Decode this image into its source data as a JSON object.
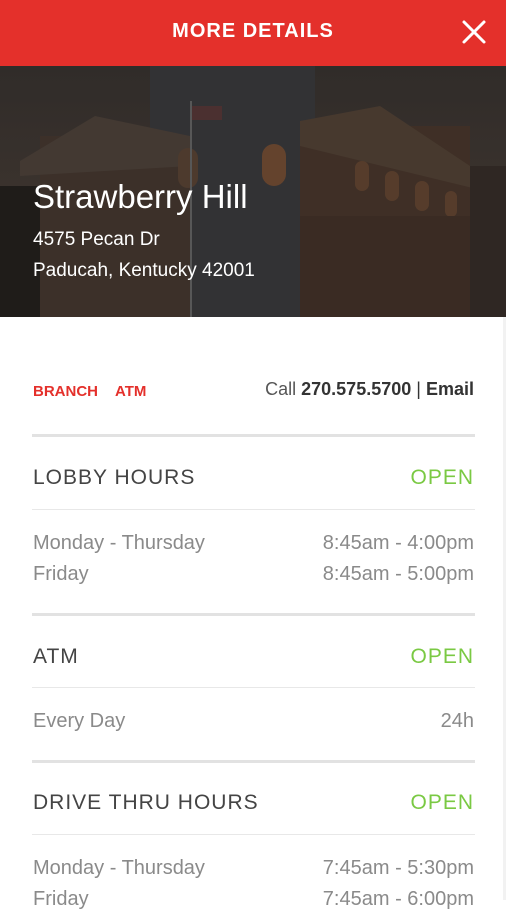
{
  "header": {
    "title": "MORE DETAILS"
  },
  "location": {
    "name": "Strawberry Hill",
    "address_line1": "4575 Pecan Dr",
    "address_line2": "Paducah, Kentucky 42001"
  },
  "tags": [
    "BRANCH",
    "ATM"
  ],
  "contact": {
    "call_label": "Call",
    "phone": "270.575.5700",
    "separator": "|",
    "email": "Email"
  },
  "sections": [
    {
      "title": "LOBBY HOURS",
      "status": "OPEN",
      "rows": [
        {
          "label": "Monday - Thursday",
          "time": "8:45am - 4:00pm"
        },
        {
          "label": "Friday",
          "time": "8:45am - 5:00pm"
        }
      ]
    },
    {
      "title": "ATM",
      "status": "OPEN",
      "rows": [
        {
          "label": "Every Day",
          "time": "24h"
        }
      ]
    },
    {
      "title": "DRIVE THRU HOURS",
      "status": "OPEN",
      "rows": [
        {
          "label": "Monday - Thursday",
          "time": "7:45am - 5:30pm"
        },
        {
          "label": "Friday",
          "time": "7:45am - 6:00pm"
        }
      ]
    }
  ],
  "colors": {
    "brand_red": "#e4302b",
    "status_open": "#7ac943",
    "muted_text": "#8a8a8a"
  },
  "icons": {
    "close": "close-icon"
  }
}
